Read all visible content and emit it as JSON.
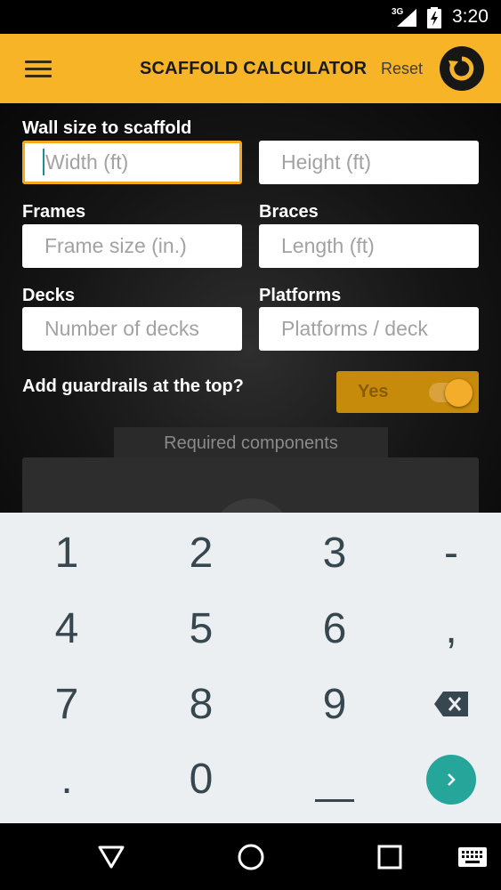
{
  "status_bar": {
    "network": "3G",
    "time": "3:20"
  },
  "app_bar": {
    "title": "SCAFFOLD CALCULATOR",
    "reset_label": "Reset"
  },
  "form": {
    "wall_label": "Wall size to scaffold",
    "width_placeholder": "Width (ft)",
    "height_placeholder": "Height (ft)",
    "frames_label": "Frames",
    "frame_placeholder": "Frame size (in.)",
    "braces_label": "Braces",
    "length_placeholder": "Length (ft)",
    "decks_label": "Decks",
    "decks_placeholder": "Number of decks",
    "platforms_label": "Platforms",
    "platforms_placeholder": "Platforms / deck",
    "guardrails_label": "Add guardrails at the top?",
    "guardrails_toggle": "Yes",
    "guardrails_on": true
  },
  "results": {
    "tab_label": "Required components"
  },
  "keyboard": {
    "keys": [
      "1",
      "2",
      "3",
      "-",
      "4",
      "5",
      "6",
      ",",
      "7",
      "8",
      "9",
      ".",
      "0"
    ]
  },
  "colors": {
    "accent": "#f7b427",
    "enter": "#26a69a"
  }
}
